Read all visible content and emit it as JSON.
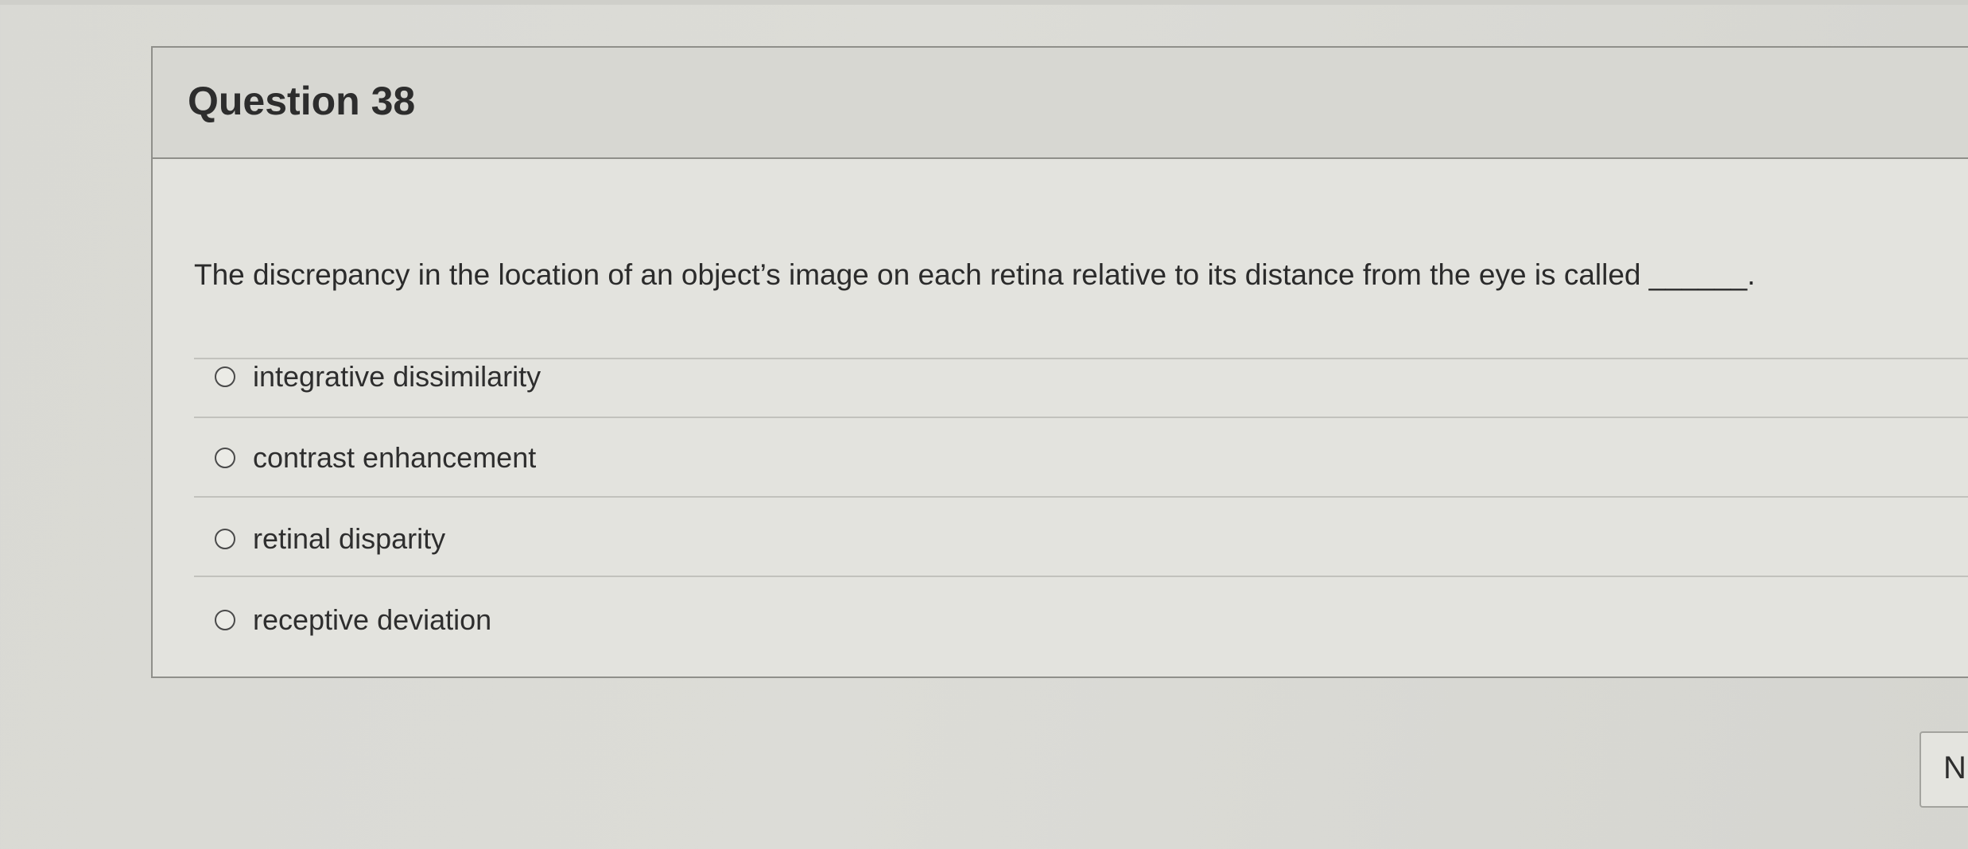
{
  "question": {
    "title": "Question 38",
    "text": "The discrepancy in the location of an object’s image on each retina relative to its distance from the eye is called ______.",
    "answers": [
      {
        "label": "integrative dissimilarity",
        "selected": false
      },
      {
        "label": "contrast enhancement",
        "selected": false
      },
      {
        "label": "retinal disparity",
        "selected": false
      },
      {
        "label": "receptive deviation",
        "selected": false
      }
    ]
  },
  "navigation": {
    "next_label": "N"
  },
  "icons": {
    "radio": "radio-button-icon"
  },
  "colors": {
    "background": "#d9d9d4",
    "card": "#e3e3de",
    "header": "#d7d7d2",
    "border": "#8f8f8a",
    "text": "#2b2b2b"
  }
}
